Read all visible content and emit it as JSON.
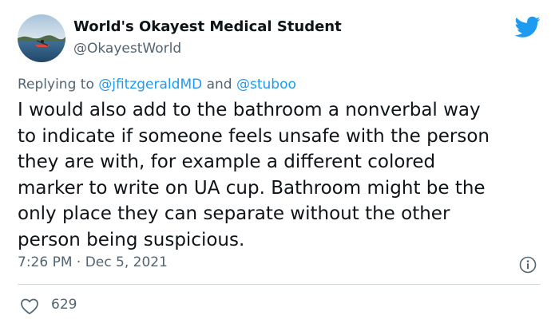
{
  "author": {
    "display_name": "World's Okayest Medical Student",
    "handle": "@OkayestWorld",
    "avatar_icon": "kayak-sunset-avatar"
  },
  "brand": {
    "logo_icon": "twitter-bird-icon",
    "accent_color": "#1d9bf0"
  },
  "reply_context": {
    "prefix": "Replying to ",
    "mention_1": "@jfitzgeraldMD",
    "conjunction": " and ",
    "mention_2": "@stuboo"
  },
  "tweet": {
    "lines": [
      "I would also add to the bathroom a nonverbal way",
      "to indicate if someone feels unsafe with the person",
      "they are with, for example a different colored",
      "marker to write on UA cup. Bathroom might be the",
      "only place they can separate without the other",
      "person being suspicious."
    ],
    "timestamp": "7:26 PM · Dec 5, 2021"
  },
  "engagement": {
    "like_icon": "heart-icon",
    "likes": "629",
    "info_icon": "info-icon"
  }
}
